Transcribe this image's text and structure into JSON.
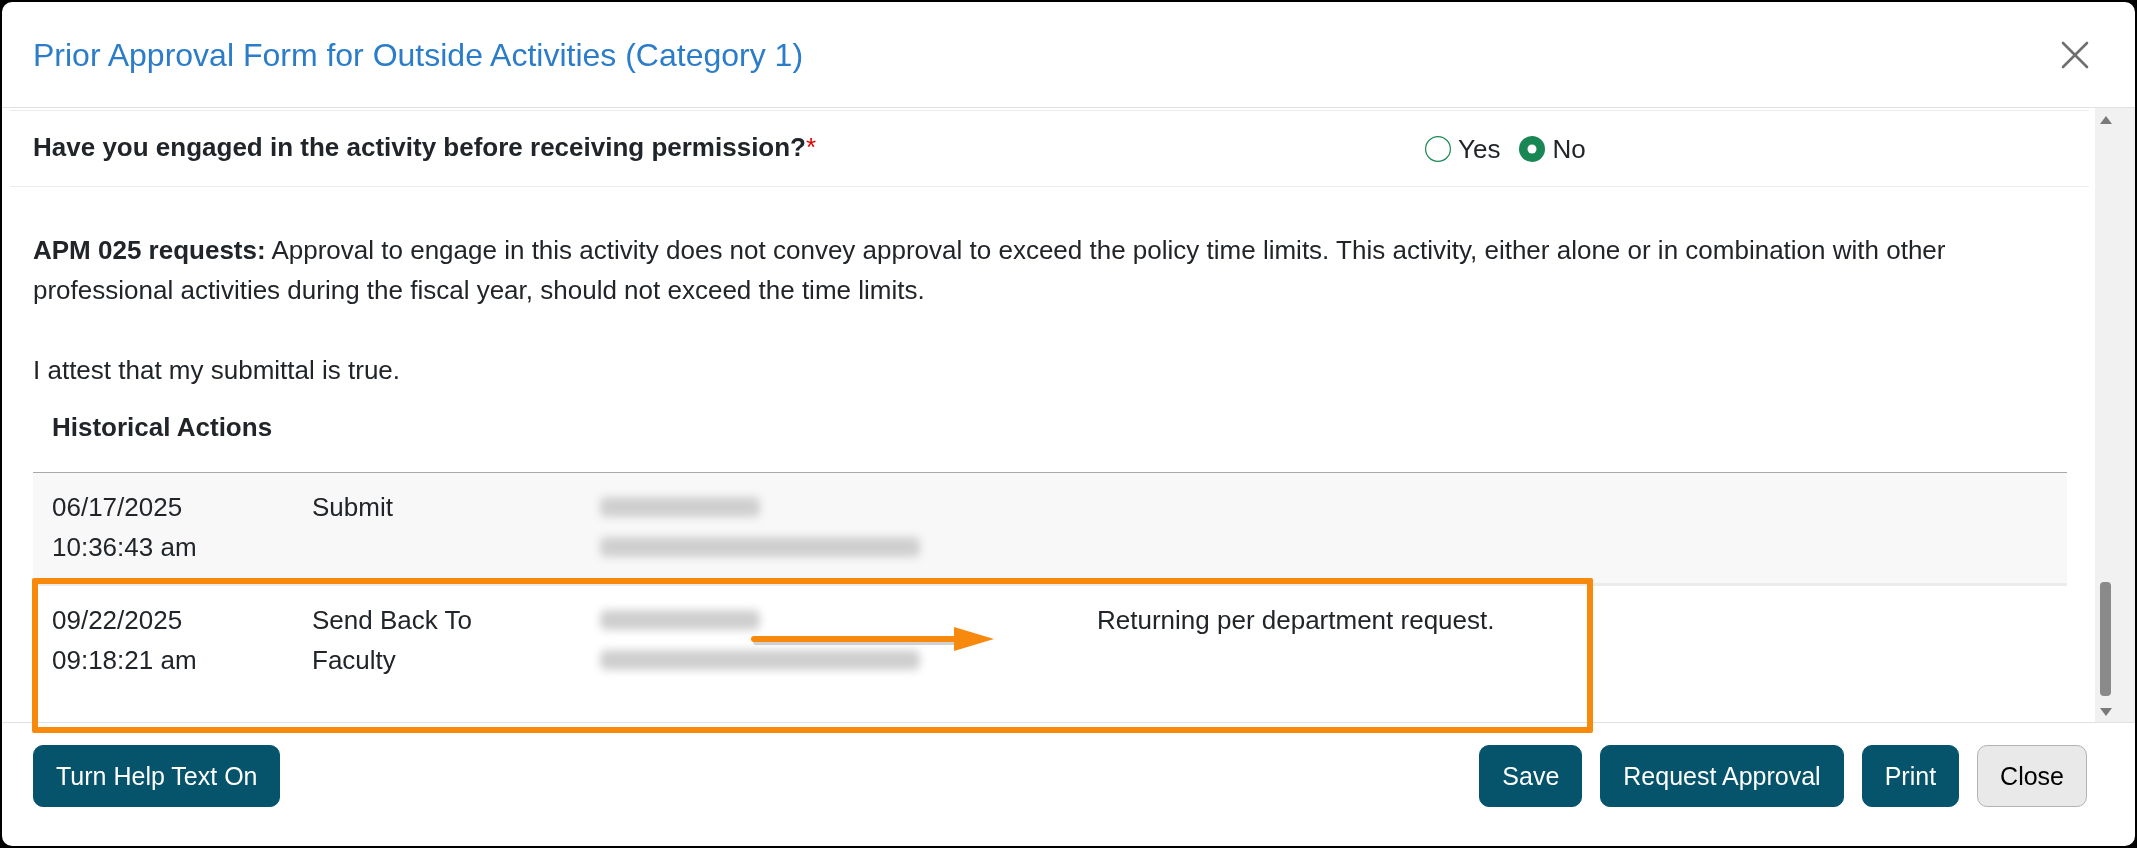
{
  "dialog": {
    "title": "Prior Approval Form for Outside Activities (Category 1)"
  },
  "question": {
    "label": "Have you engaged in the activity before receiving permission?",
    "required_mark": "*",
    "options": [
      {
        "label": "Yes",
        "selected": false
      },
      {
        "label": "No",
        "selected": true
      }
    ]
  },
  "notice": "**APM 025 requests:** Approval to engage in this activity does not convey approval to exceed the policy time limits. This activity, either alone or in combination with other professional activities during the fiscal year, should not exceed the time limits.",
  "attestation": "I attest that my submittal is true.",
  "history": {
    "title": "Historical Actions",
    "rows": [
      {
        "date": "06/17/2025",
        "time": "10:36:43 am",
        "action": "Submit",
        "highlighted": false
      },
      {
        "date": "09/22/2025",
        "time": "09:18:21 am",
        "action": "Send Back To Faculty",
        "comment": "Returning per department request.",
        "highlighted": true
      }
    ]
  },
  "footer": {
    "left_buttons": [
      {
        "label": "Turn Help Text On",
        "kind": "primary"
      }
    ],
    "right_buttons": [
      {
        "label": "Save",
        "kind": "primary"
      },
      {
        "label": "Request Approval",
        "kind": "primary"
      },
      {
        "label": "Print",
        "kind": "primary"
      },
      {
        "label": "Close",
        "kind": "secondary"
      }
    ]
  }
}
